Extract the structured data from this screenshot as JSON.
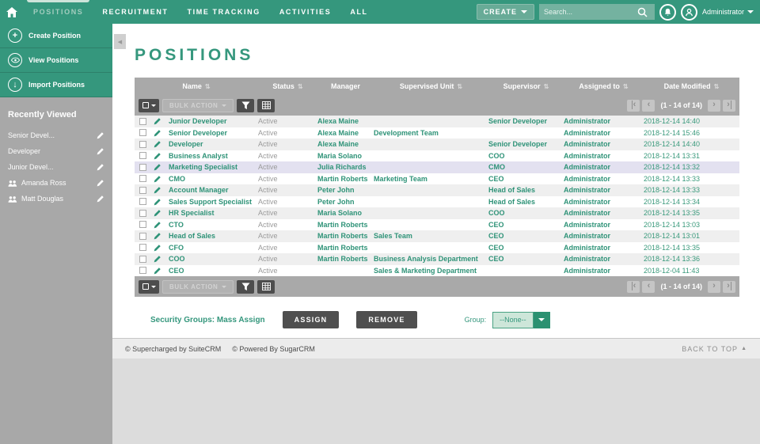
{
  "nav": {
    "tabs": [
      {
        "label": "POSITIONS",
        "active": true
      },
      {
        "label": "RECRUITMENT",
        "active": false
      },
      {
        "label": "TIME TRACKING",
        "active": false
      },
      {
        "label": "ACTIVITIES",
        "active": false
      },
      {
        "label": "ALL",
        "active": false
      }
    ],
    "create_label": "CREATE",
    "search_placeholder": "Search...",
    "user_label": "Administrator"
  },
  "sidebar": {
    "actions": [
      {
        "label": "Create Position",
        "icon": "plus-icon"
      },
      {
        "label": "View Positions",
        "icon": "eye-icon"
      },
      {
        "label": "Import Positions",
        "icon": "download-icon"
      }
    ],
    "recent_title": "Recently Viewed",
    "recent_items": [
      {
        "label": "Senior Devel..."
      },
      {
        "label": "Developer"
      },
      {
        "label": "Junior Devel..."
      },
      {
        "label": "Amanda Ross",
        "people_icon": true
      },
      {
        "label": "Matt Douglas",
        "people_icon": true
      }
    ]
  },
  "main": {
    "title": "POSITIONS",
    "table": {
      "columns": [
        {
          "label": "Name",
          "sortable": true
        },
        {
          "label": "Status",
          "sortable": true
        },
        {
          "label": "Manager",
          "sortable": false
        },
        {
          "label": "Supervised Unit",
          "sortable": true
        },
        {
          "label": "Supervisor",
          "sortable": true
        },
        {
          "label": "Assigned to",
          "sortable": true
        },
        {
          "label": "Date Modified",
          "sortable": true
        }
      ],
      "bulk_action_label": "BULK ACTION",
      "pagination": "(1 - 14 of 14)",
      "rows": [
        {
          "name": "Junior Developer",
          "status": "Active",
          "manager": "Alexa Maine",
          "supervised_unit": "",
          "supervisor": "Senior Developer",
          "assigned_to": "Administrator",
          "date_modified": "2018-12-14 14:40"
        },
        {
          "name": "Senior Developer",
          "status": "Active",
          "manager": "Alexa Maine",
          "supervised_unit": "Development Team",
          "supervisor": "",
          "assigned_to": "Administrator",
          "date_modified": "2018-12-14 15:46"
        },
        {
          "name": "Developer",
          "status": "Active",
          "manager": "Alexa Maine",
          "supervised_unit": "",
          "supervisor": "Senior Developer",
          "assigned_to": "Administrator",
          "date_modified": "2018-12-14 14:40"
        },
        {
          "name": "Business Analyst",
          "status": "Active",
          "manager": "Maria Solano",
          "supervised_unit": "",
          "supervisor": "COO",
          "assigned_to": "Administrator",
          "date_modified": "2018-12-14 13:31"
        },
        {
          "name": "Marketing Specialist",
          "status": "Active",
          "manager": "Julia Richards",
          "supervised_unit": "",
          "supervisor": "CMO",
          "assigned_to": "Administrator",
          "date_modified": "2018-12-14 13:32",
          "highlighted": true
        },
        {
          "name": "CMO",
          "status": "Active",
          "manager": "Martin Roberts",
          "supervised_unit": "Marketing Team",
          "supervisor": "CEO",
          "assigned_to": "Administrator",
          "date_modified": "2018-12-14 13:33"
        },
        {
          "name": "Account Manager",
          "status": "Active",
          "manager": "Peter John",
          "supervised_unit": "",
          "supervisor": "Head of Sales",
          "assigned_to": "Administrator",
          "date_modified": "2018-12-14 13:33"
        },
        {
          "name": "Sales Support Specialist",
          "status": "Active",
          "manager": "Peter John",
          "supervised_unit": "",
          "supervisor": "Head of Sales",
          "assigned_to": "Administrator",
          "date_modified": "2018-12-14 13:34"
        },
        {
          "name": "HR Specialist",
          "status": "Active",
          "manager": "Maria Solano",
          "supervised_unit": "",
          "supervisor": "COO",
          "assigned_to": "Administrator",
          "date_modified": "2018-12-14 13:35"
        },
        {
          "name": "CTO",
          "status": "Active",
          "manager": "Martin Roberts",
          "supervised_unit": "",
          "supervisor": "CEO",
          "assigned_to": "Administrator",
          "date_modified": "2018-12-14 13:03"
        },
        {
          "name": "Head of Sales",
          "status": "Active",
          "manager": "Martin Roberts",
          "supervised_unit": "Sales Team",
          "supervisor": "CEO",
          "assigned_to": "Administrator",
          "date_modified": "2018-12-14 13:01"
        },
        {
          "name": "CFO",
          "status": "Active",
          "manager": "Martin Roberts",
          "supervised_unit": "",
          "supervisor": "CEO",
          "assigned_to": "Administrator",
          "date_modified": "2018-12-14 13:35"
        },
        {
          "name": "COO",
          "status": "Active",
          "manager": "Martin Roberts",
          "supervised_unit": "Business Analysis Department",
          "supervisor": "CEO",
          "assigned_to": "Administrator",
          "date_modified": "2018-12-14 13:36"
        },
        {
          "name": "CEO",
          "status": "Active",
          "manager": "",
          "supervised_unit": "Sales & Marketing Department",
          "supervisor": "",
          "assigned_to": "Administrator",
          "date_modified": "2018-12-04 11:43"
        }
      ]
    },
    "mass_assign": {
      "title": "Security Groups: Mass Assign",
      "assign_label": "ASSIGN",
      "remove_label": "REMOVE",
      "group_label": "Group:",
      "group_value": "--None--"
    }
  },
  "footer": {
    "credit1": "© Supercharged by SuiteCRM",
    "credit2": "© Powered By SugarCRM",
    "back_to_top": "BACK TO TOP"
  },
  "icons": {
    "sort": "⇅",
    "collapse_left": "◀",
    "plus": "+",
    "download_arrow": "↓",
    "pager_prev": "‹",
    "pager_next": "›",
    "up_arrow": "▲"
  }
}
